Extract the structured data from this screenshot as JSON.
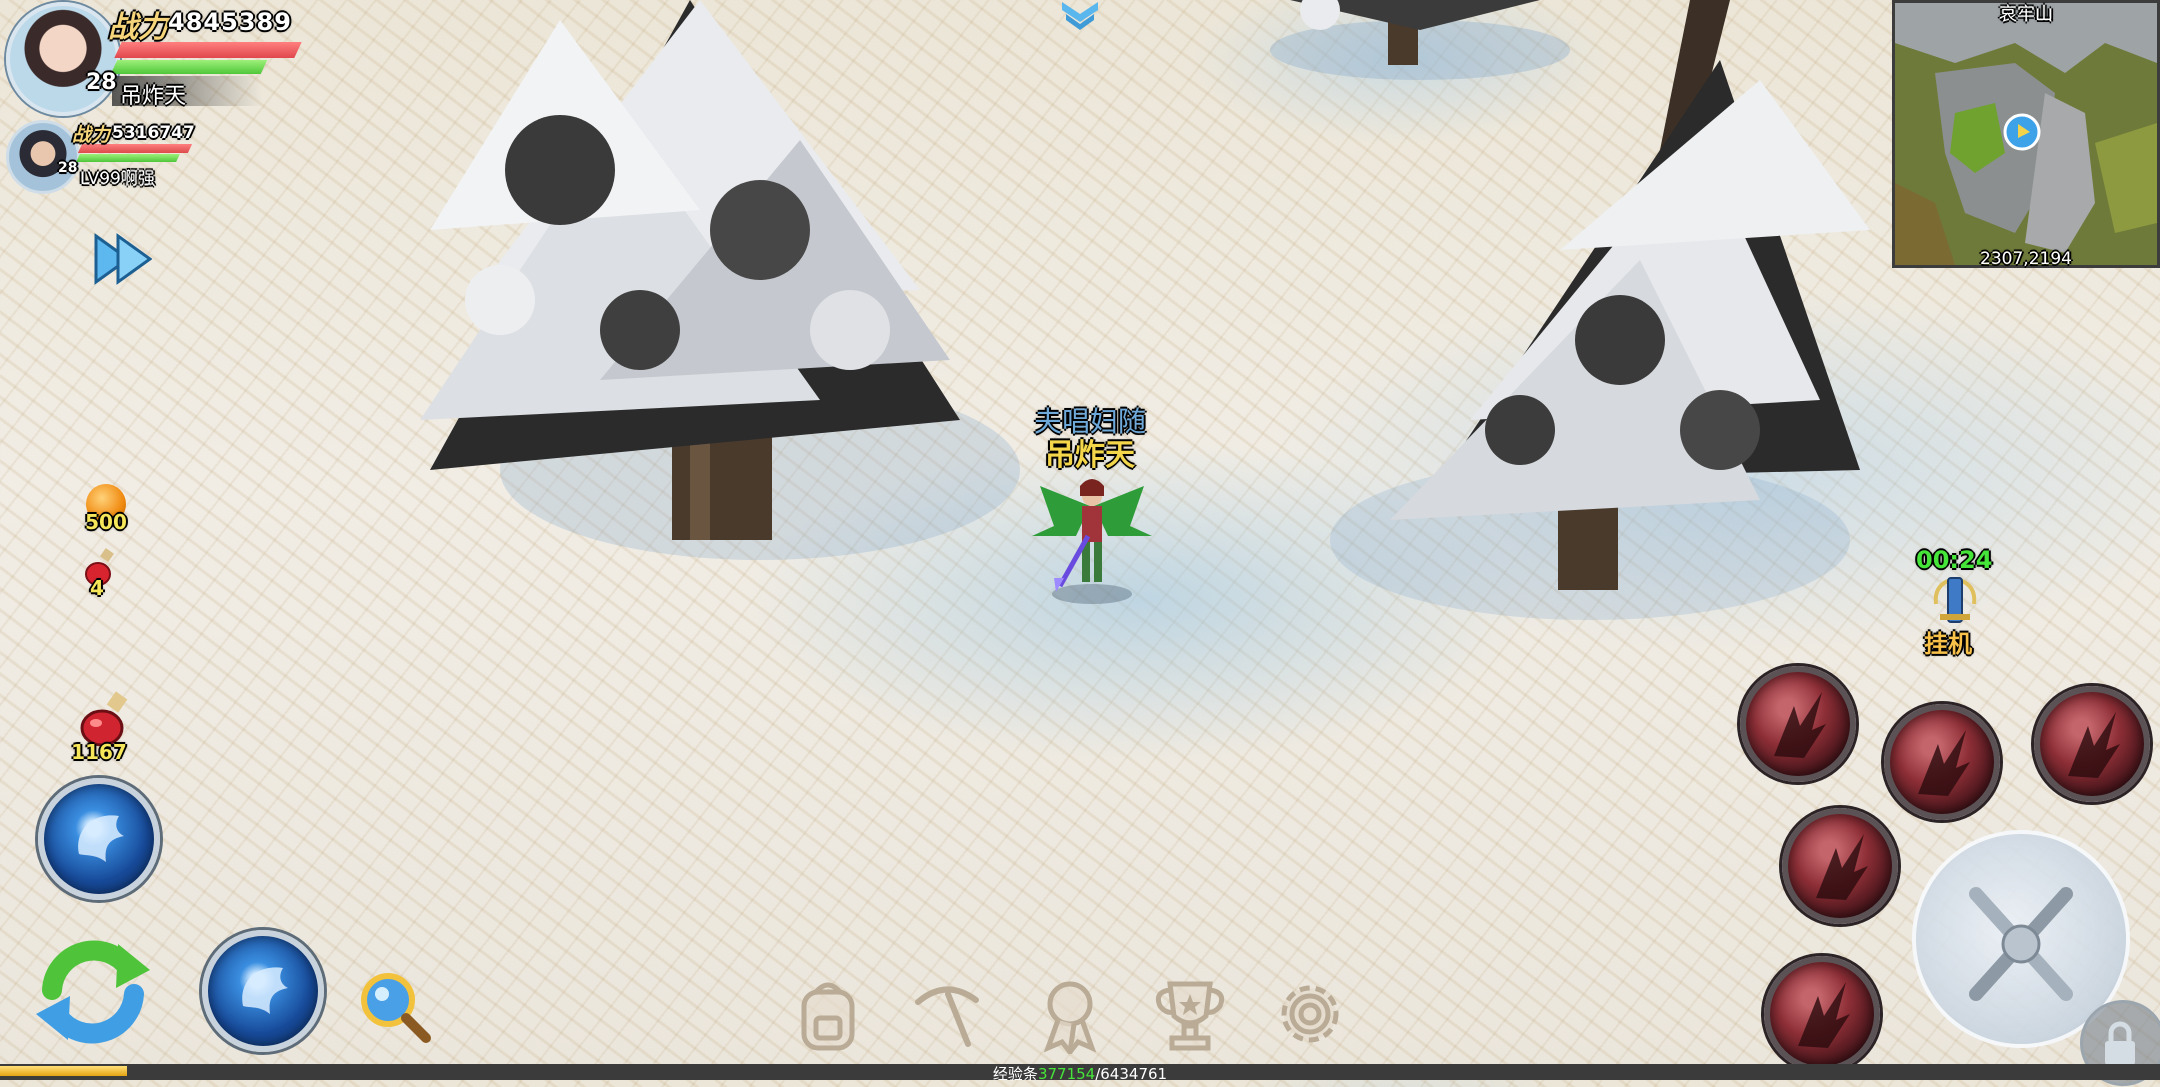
{
  "player": {
    "power_label": "战力",
    "power": "4845389",
    "level": "28",
    "name": "吊炸天"
  },
  "pet": {
    "power_label": "战力",
    "power": "5316747",
    "level": "28",
    "name": "LV99啊强"
  },
  "minimap": {
    "title": "哀牢山",
    "coords": "2307,2194"
  },
  "items": [
    {
      "icon": "orange-fruit-icon",
      "count": "500"
    },
    {
      "icon": "small-potion-icon",
      "count": "4"
    },
    {
      "icon": "large-potion-icon",
      "count": "1167"
    }
  ],
  "character": {
    "title": "夫唱妇随",
    "name": "吊炸天"
  },
  "auto_battle": {
    "timer": "00:24",
    "label": "挂机"
  },
  "bottom_menu": [
    {
      "icon": "backpack-icon"
    },
    {
      "icon": "pickaxe-icon"
    },
    {
      "icon": "medal-icon"
    },
    {
      "icon": "trophy-icon"
    },
    {
      "icon": "settings-gear-icon"
    }
  ],
  "exp": {
    "label": "经验条",
    "current": "377154",
    "separator": "/",
    "max": "6434761",
    "fill_fraction": 0.059
  },
  "colors": {
    "power_label": "#f5d47a",
    "hp": "#e0474d",
    "mp": "#4fc63a",
    "char_name": "#f3d64a",
    "char_title": "#6ea9da",
    "timer": "#46e53a",
    "auto_label": "#f8c14a",
    "exp_current": "#46e53a"
  }
}
